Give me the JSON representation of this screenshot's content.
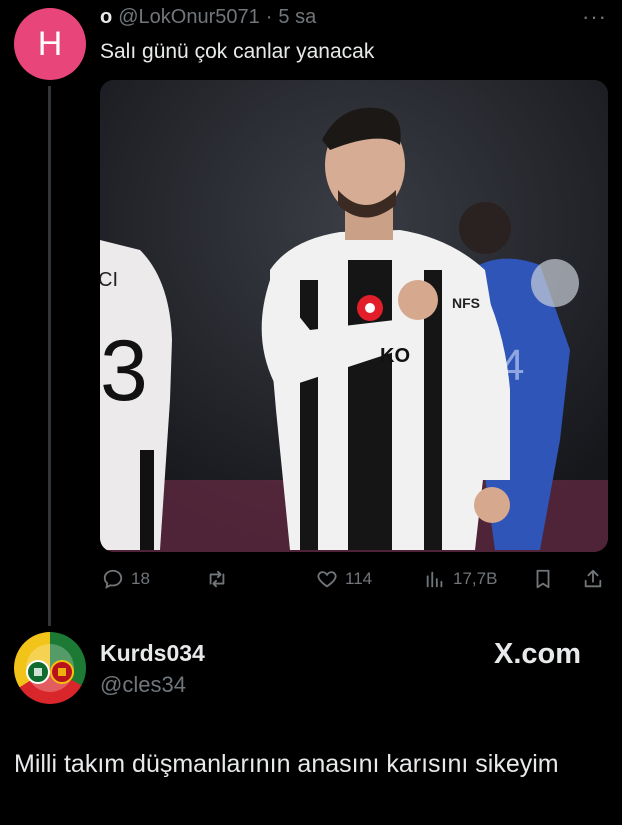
{
  "reply_tweet": {
    "avatar_letter": "H",
    "display_name": "o",
    "handle": "@LokOnur5071",
    "separator": "·",
    "time": "5 sa",
    "more": "···",
    "text": "Salı günü çok canlar yanacak",
    "image": {
      "jersey_number": "3",
      "jersey_letters": "CI",
      "badge_text": "KO",
      "sleeve_text": "NFS",
      "bg_number": "4"
    },
    "actions": {
      "replies": "18",
      "retweets": "",
      "likes": "114",
      "views": "17,7B"
    }
  },
  "quoted_tweet": {
    "username": "Kurds034",
    "handle": "@cles34",
    "brand": "X.com",
    "text": "Milli takım düşmanlarının anasını karısını sikeyim"
  },
  "colors": {
    "avatar_bg": "#e8457a",
    "muted_text": "#71767b",
    "primary_text": "#e7e9ea",
    "background": "#000000"
  }
}
